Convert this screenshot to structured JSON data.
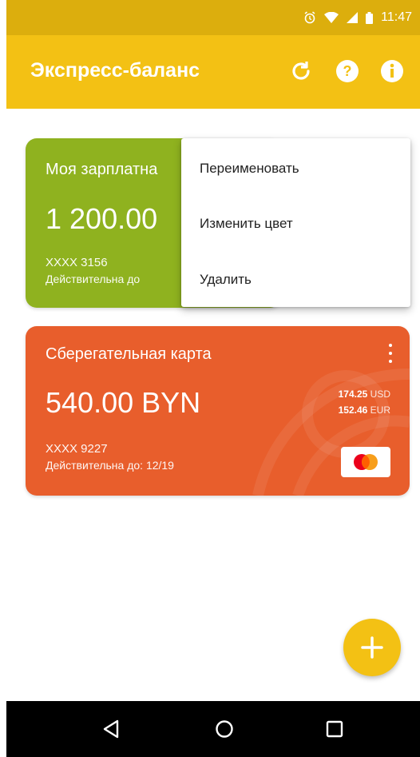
{
  "status_bar": {
    "time": "11:47",
    "icons": [
      "alarm-icon",
      "wifi-icon",
      "signal-icon",
      "battery-icon"
    ]
  },
  "toolbar": {
    "title": "Экспресс-баланс",
    "actions": [
      "refresh-icon",
      "help-icon",
      "info-icon"
    ],
    "color": "#f3c114"
  },
  "cards": [
    {
      "name": "Моя зарплатна",
      "amount": "1 200.00",
      "number": "XXXX 3156",
      "validity": "Действительна до",
      "color": "#8fb21f"
    },
    {
      "name": "Сберегательная карта",
      "amount": "540.00 BYN",
      "conversions": [
        {
          "value": "174.25",
          "currency": "USD"
        },
        {
          "value": "152.46",
          "currency": "EUR"
        }
      ],
      "number": "XXXX 9227",
      "validity": "Действительна до: 12/19",
      "color": "#e85e2c",
      "payment_system": "mastercard-icon"
    }
  ],
  "context_menu": {
    "items": [
      "Переименовать",
      "Изменить цвет",
      "Удалить"
    ]
  },
  "fab": {
    "icon": "plus-icon"
  },
  "navbar": {
    "icons": [
      "back-icon",
      "home-icon",
      "recents-icon"
    ]
  }
}
